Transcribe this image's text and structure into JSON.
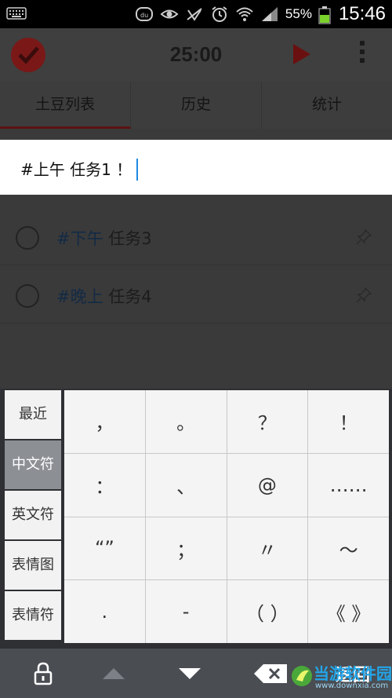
{
  "status_bar": {
    "battery_percent": "55%",
    "time": "15:46",
    "icons": [
      "keyboard-icon",
      "baidu-icon",
      "eye-icon",
      "no-signal-icon",
      "alarm-icon",
      "wifi-icon",
      "cell-signal-icon",
      "battery-icon"
    ]
  },
  "app_bar": {
    "timer": "25:00",
    "icons": [
      "tomato-check-logo-icon",
      "play-icon",
      "overflow-menu-icon"
    ]
  },
  "tabs": [
    {
      "label": "土豆列表",
      "active": true
    },
    {
      "label": "历史",
      "active": false
    },
    {
      "label": "统计",
      "active": false
    }
  ],
  "input": {
    "value": "#上午 任务1 ！"
  },
  "tasks": [
    {
      "tag": "#下午",
      "title": " 任务3"
    },
    {
      "tag": "#晚上",
      "title": " 任务4"
    }
  ],
  "keyboard": {
    "categories": [
      {
        "label": "最近",
        "active": false
      },
      {
        "label": "中文符",
        "active": true
      },
      {
        "label": "英文符",
        "active": false
      },
      {
        "label": "表情图",
        "active": false
      },
      {
        "label": "表情符",
        "active": false
      }
    ],
    "keys": [
      "，",
      "。",
      "？",
      "！",
      "：",
      "、",
      "@",
      "……",
      "“”",
      "；",
      "〃",
      "～",
      ".",
      "-",
      "（ ）",
      "《 》"
    ],
    "bottom": {
      "enter_label": "返回"
    }
  },
  "watermark": {
    "text": "当游软件园",
    "url": "www.downxia.com"
  },
  "colors": {
    "accent_blue": "#1e88e5",
    "brand_red": "#d32f2f",
    "active_category": "#8c8f94"
  }
}
